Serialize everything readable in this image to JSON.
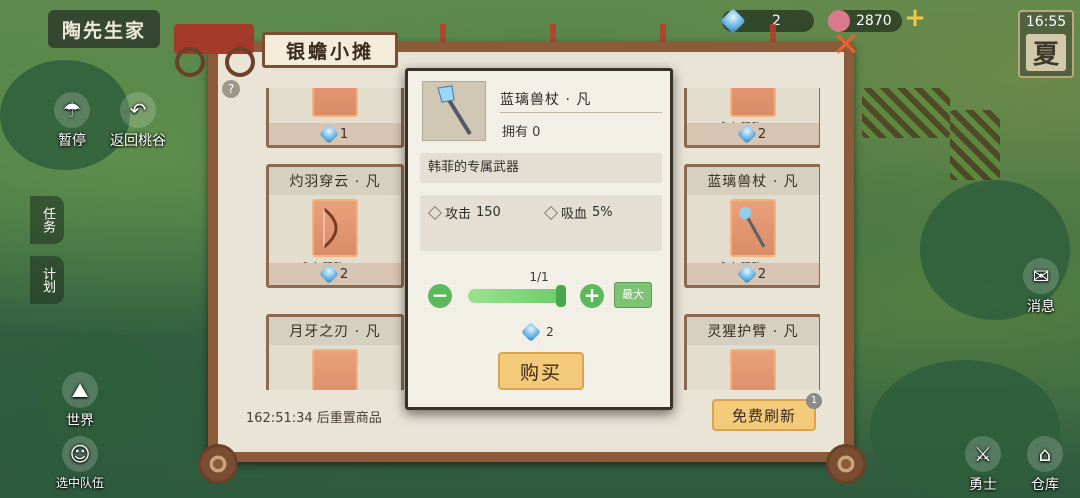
{
  "hud": {
    "character_name": "陶先生家",
    "left_buttons": [
      {
        "label": "暂停",
        "icon": "umbrella-icon"
      },
      {
        "label": "返回桃谷",
        "icon": "return-icon"
      },
      {
        "label": "世界",
        "icon": "world-icon"
      },
      {
        "label": "选中队伍",
        "icon": "team-icon"
      }
    ],
    "side_tabs": [
      "任务",
      "计划"
    ],
    "gem_count": "2",
    "coin_count": "2870",
    "add_symbol": "+",
    "time": "16:55",
    "season": "夏",
    "right_buttons": [
      {
        "label": "消息",
        "icon": "message-icon"
      },
      {
        "label": "勇士",
        "icon": "warrior-icon"
      },
      {
        "label": "仓库",
        "icon": "warehouse-icon"
      }
    ]
  },
  "shop": {
    "title": "银蟾小摊",
    "close_symbol": "✕",
    "help_symbol": "?",
    "reset_timer": "162:51:34 后重置商品",
    "refresh_label": "免费刷新",
    "refresh_badge": "1",
    "items": [
      {
        "name": "",
        "limit": "",
        "price": "1"
      },
      {
        "name": "",
        "limit": "永久限购: 1/1",
        "price": "2"
      },
      {
        "name": "灼羽穿云 · 凡",
        "limit": "永久限购: 1/1",
        "price": "2"
      },
      {
        "name": "蓝璃兽杖 · 凡",
        "limit": "永久限购: 1/1",
        "price": "2"
      },
      {
        "name": "月牙之刃 · 凡",
        "limit": "",
        "price": ""
      },
      {
        "name": "灵猩护臂 · 凡",
        "limit": "",
        "price": ""
      }
    ]
  },
  "detail": {
    "name": "蓝璃兽杖 · 凡",
    "owned": "拥有 0",
    "description": "韩菲的专属武器",
    "stats": [
      {
        "label": "攻击",
        "value": "150"
      },
      {
        "label": "吸血",
        "value": "5%"
      }
    ],
    "quantity": "1/1",
    "minus_symbol": "−",
    "plus_symbol": "+",
    "quantity_fraction": 1.0,
    "max_label": "最大",
    "price": "2",
    "buy_label": "购买"
  },
  "colors": {
    "frame": "#8b5b3a",
    "button": "#f3c97a",
    "green": "#5cb85c",
    "close": "#e8602e"
  }
}
